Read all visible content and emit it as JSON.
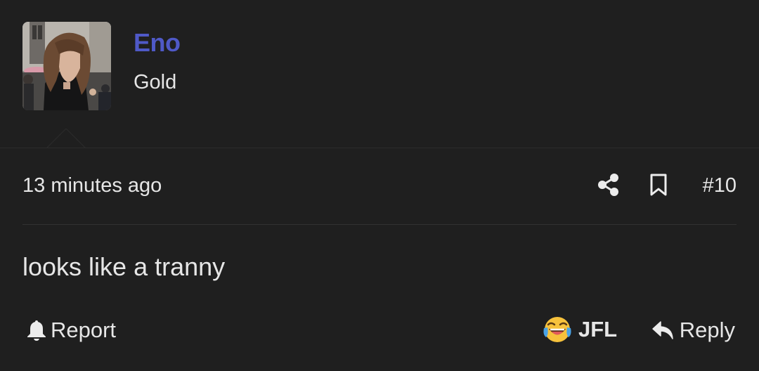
{
  "user": {
    "name": "Eno",
    "title": "Gold",
    "name_color": "#4f59c7"
  },
  "meta": {
    "timestamp": "13 minutes ago",
    "post_number": "#10",
    "icons": [
      "share-icon",
      "bookmark-icon"
    ]
  },
  "message": {
    "text": "looks like a tranny"
  },
  "actions": {
    "report_label": "Report",
    "report_icon": "bell-icon",
    "reaction_label": "JFL",
    "reaction_icon": "crying-laughing-emoji-icon",
    "reply_label": "Reply",
    "reply_icon": "reply-arrow-icon"
  },
  "colors": {
    "background": "#1f1f1f",
    "text": "#e6e6e6",
    "username": "#4f59c7"
  }
}
